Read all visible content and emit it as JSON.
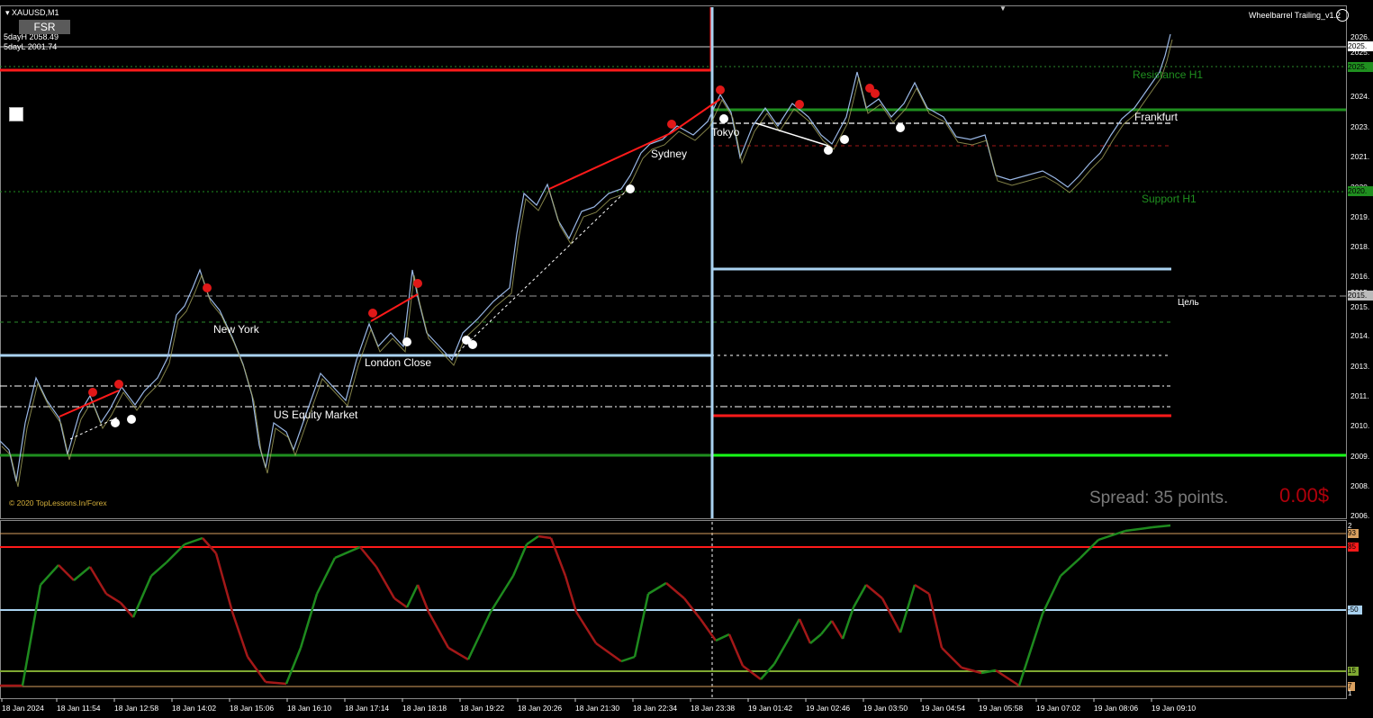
{
  "header": {
    "symbol": "XAUUSD,M1",
    "day_high": "5dayH 2058.49",
    "day_low": "5dayL 2001.74",
    "fsr_button": "FSR",
    "indicator_name": "Wheelbarrel Trailing_v1.2"
  },
  "price_axis": {
    "ticks": [
      "2026.",
      "2025.",
      "2024.",
      "2023.",
      "2021.",
      "2020.",
      "2019.",
      "2018.",
      "2016.",
      "2015.",
      "2015.",
      "2014.",
      "2013.",
      "2011.",
      "2010.",
      "2009.",
      "2008.",
      "2006."
    ],
    "marker_current": "2025.",
    "marker_resistance": "2025.",
    "marker_support": "2020.",
    "marker_target": "2015."
  },
  "time_axis": {
    "ticks": [
      "18 Jan 2024",
      "18 Jan 11:54",
      "18 Jan 12:58",
      "18 Jan 14:02",
      "18 Jan 15:06",
      "18 Jan 16:10",
      "18 Jan 17:14",
      "18 Jan 18:18",
      "18 Jan 19:22",
      "18 Jan 20:26",
      "18 Jan 21:30",
      "18 Jan 22:34",
      "18 Jan 23:38",
      "19 Jan 01:42",
      "19 Jan 02:46",
      "19 Jan 03:50",
      "19 Jan 04:54",
      "19 Jan 05:58",
      "19 Jan 07:02",
      "19 Jan 08:06",
      "19 Jan 09:10"
    ]
  },
  "sessions": {
    "new_york": "New York",
    "london_close": "London Close",
    "us_equity": "US Equity Market",
    "sydney": "Sydney",
    "tokyo": "Tokyo",
    "frankfurt": "Frankfurt"
  },
  "levels": {
    "resistance": "Resistance H1",
    "support": "Support H1",
    "target": "Цель"
  },
  "status": {
    "spread": "Spread: 35 points.",
    "profit": "0.00$",
    "copyright": "© 2020 TopLessons.In/Forex"
  },
  "oscillator_axis": {
    "ticks": [
      "93",
      "85",
      "-50",
      "15",
      "7"
    ],
    "top": "2",
    "bottom": "1"
  },
  "colors": {
    "background": "#000000",
    "price_line": "#9ab8e6",
    "bull_bar": "#a4a35a",
    "resistance_red": "#ff1a1a",
    "support_green": "#1f8f1f",
    "bright_green": "#18ff18",
    "light_blue": "#a9d2f0",
    "osc_up": "#1e8a1e",
    "osc_down": "#a31818"
  }
}
